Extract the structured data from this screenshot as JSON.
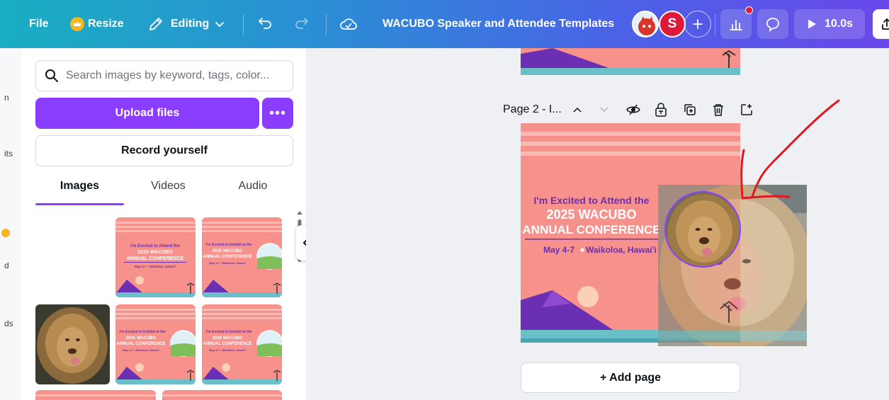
{
  "topbar": {
    "file_label": "File",
    "resize_label": "Resize",
    "editing_label": "Editing",
    "title": "WACUBO Speaker and Attendee Templates",
    "avatar_initial": "S",
    "play_time": "10.0s"
  },
  "rail": {
    "items": [
      "n",
      "its",
      "d",
      "ds"
    ]
  },
  "panel": {
    "search_placeholder": "Search images by keyword, tags, color...",
    "upload_label": "Upload files",
    "more_label": "•••",
    "record_label": "Record yourself",
    "tabs": [
      {
        "label": "Images"
      },
      {
        "label": "Videos"
      },
      {
        "label": "Audio"
      }
    ],
    "thumbnails": [
      {
        "line1": "I'm Excited to Attend the",
        "line2": "2025 WACUBO",
        "line3": "ANNUAL CONFERENCE",
        "line4": "May 4-7 • Waikoloa, Hawai'i"
      },
      {
        "line1": "I'm Excited to Exhibit at the",
        "line2": "2025 WACUBO",
        "line3": "ANNUAL CONFERENCE",
        "line4": "May 4-7 • Waikoloa, Hawai'i"
      },
      {
        "line1": "I'm Excited to Exhibit at the",
        "line2": "2025 WACUBO",
        "line3": "ANNUAL CONFERENCE",
        "line4": "May 4-7 • Waikoloa, Hawai'i"
      },
      {
        "line1": "I'm Excited to Exhibit at the",
        "line2": "2025 WACUBO",
        "line3": "ANNUAL CONFERENCE",
        "line4": "May 4-7 • Waikoloa, Hawai'i"
      }
    ]
  },
  "canvas": {
    "page_label": "Page 2 - I...",
    "design": {
      "line1": "I'm Excited to Attend the",
      "line2": "2025 WACUBO",
      "line3": "ANNUAL CONFERENCE",
      "date": "May 4-7",
      "location": "Waikoloa, Hawai'i"
    },
    "add_page_label": "+ Add page"
  },
  "colors": {
    "brand_purple": "#8b3dff",
    "design_pink": "#f7918c",
    "design_purple": "#6b2fb3",
    "annotation_red": "#e0191f"
  }
}
